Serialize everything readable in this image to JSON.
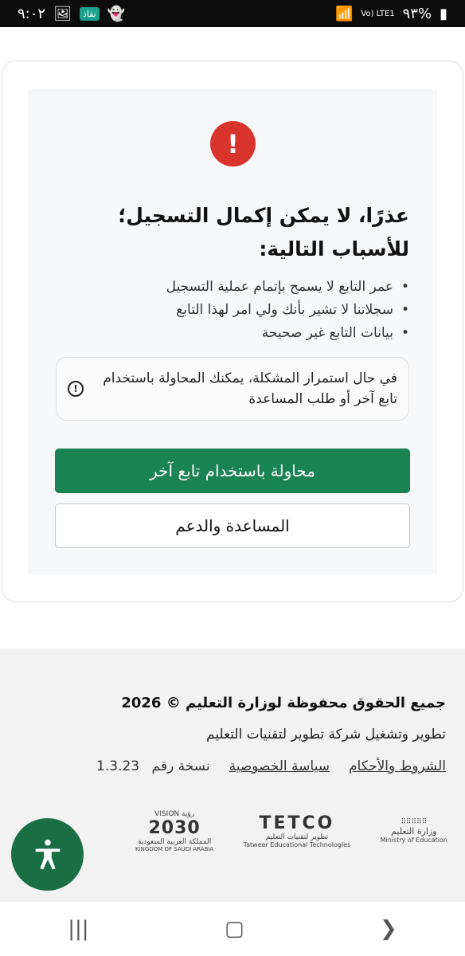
{
  "status_bar": {
    "time": "٩:٠٢",
    "battery": "٩٣%",
    "network": "Vo) LTE1",
    "app_badge": "نقاذ"
  },
  "error": {
    "title": "عذرًا، لا يمكن إكمال التسجيل؛ للأسباب التالية:",
    "reasons": [
      "عمر التابع لا يسمح بإتمام عملية التسجيل",
      "سجلاتنا لا تشير بأنك ولي امر لهذا التابع",
      "بيانات التابع غير صحيحة"
    ],
    "note": "في حال استمرار المشكلة، يمكنك المحاولة باستخدام تابع آخر أو طلب المساعدة"
  },
  "actions": {
    "retry_label": "محاولة باستخدام تابع آخر",
    "help_label": "المساعدة والدعم"
  },
  "footer": {
    "copyright": "جميع الحقوق محفوظة لوزارة التعليم © 2026",
    "developer": "تطوير وتشغيل شركة تطوير لتقنيات التعليم",
    "terms_link": "الشروط والأحكام",
    "privacy_link": "سياسة الخصوصية",
    "version_label": "نسخة رقم",
    "version": "1.3.23",
    "logos": {
      "ministry_ar": "وزارة التعليم",
      "ministry_en": "Ministry of Education",
      "tetco": "TETCO",
      "tetco_ar": "تطوير لتقنيات التعليم",
      "tetco_en": "Tatweer Educational Technologies",
      "vision_top": "VISION رؤية",
      "vision_year": "2030",
      "vision_ar": "المملكة العربية السعودية",
      "vision_en": "KINGDOM OF SAUDI ARABIA"
    }
  },
  "colors": {
    "primary": "#1a8352",
    "error": "#d9342b",
    "accessibility": "#1a6e44"
  }
}
